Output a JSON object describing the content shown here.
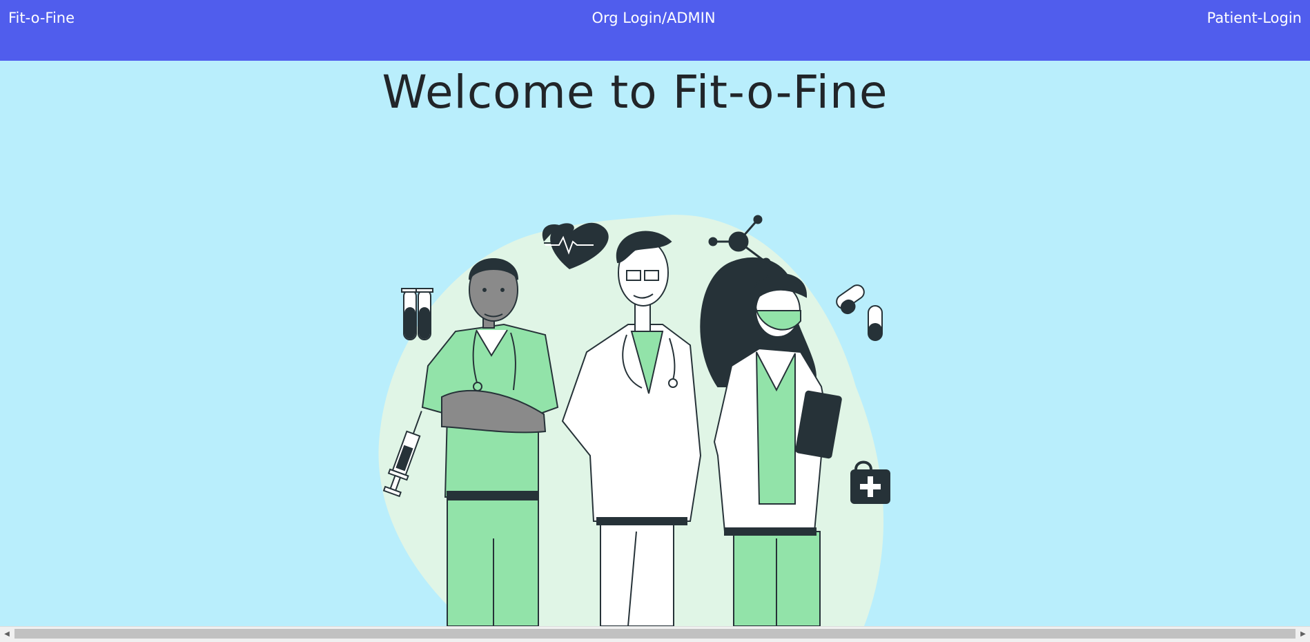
{
  "navbar": {
    "brand": "Fit-o-Fine",
    "org_login": "Org Login/ADMIN",
    "patient_login": "Patient-Login",
    "background": "#505ded"
  },
  "main": {
    "title": "Welcome to Fit-o-Fine",
    "background": "#b9eefc"
  },
  "illustration": {
    "icons": [
      "test-tubes-icon",
      "heart-pulse-icon",
      "molecule-icon",
      "pill-icon",
      "syringe-icon",
      "first-aid-kit-icon"
    ],
    "figures": [
      "nurse",
      "doctor",
      "female-doctor"
    ],
    "colors": {
      "scrubs": "#92e3a9",
      "blob": "#e0f5e6",
      "ink": "#263238"
    }
  },
  "scrollbar": {
    "left_arrow": "◀",
    "right_arrow": "▶"
  }
}
